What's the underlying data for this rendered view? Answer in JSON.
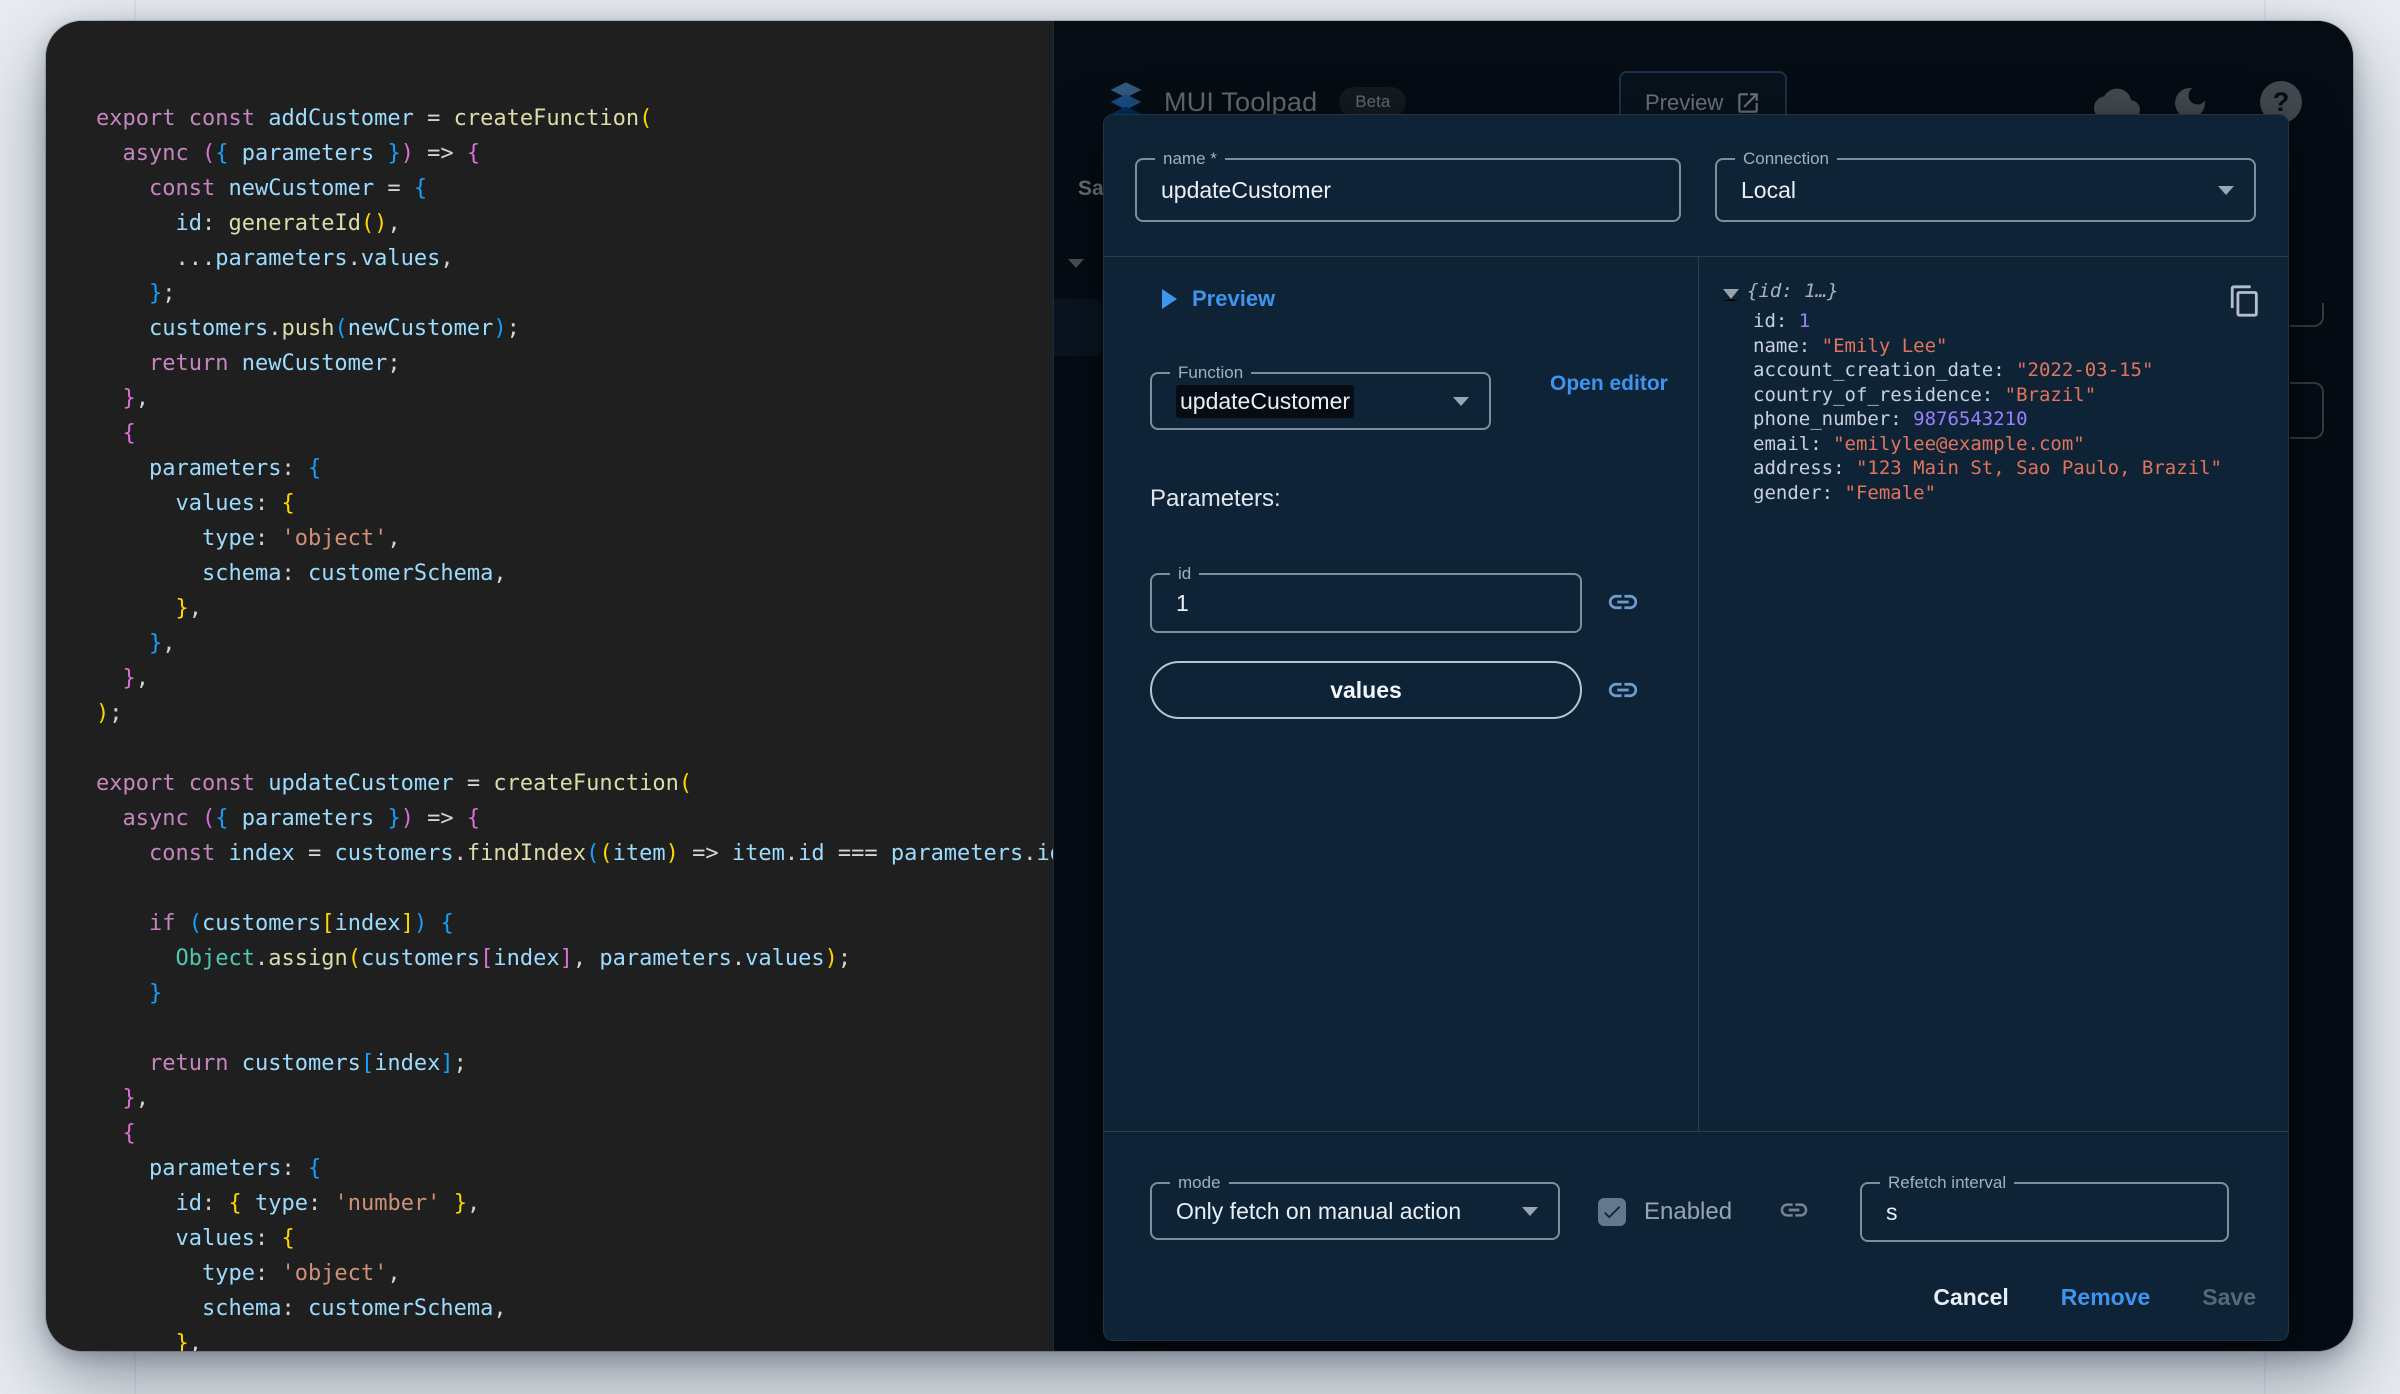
{
  "header": {
    "app_name": "MUI Toolpad",
    "beta_badge": "Beta",
    "preview_button": "Preview"
  },
  "background_ui": {
    "save_button_partial": "Sa"
  },
  "icons": {
    "help": "?"
  },
  "colors": {
    "accent_blue": "#3F94EE",
    "code_background": "#1f1f1f",
    "app_background": "#0A1929",
    "dialog_background": "#0f2337",
    "json_string": "#e0745c",
    "json_number": "#9980ff"
  },
  "code": {
    "lines": [
      [
        [
          "k",
          "export"
        ],
        [
          "p",
          " "
        ],
        [
          "k",
          "const"
        ],
        [
          "p",
          " "
        ],
        [
          "v",
          "addCustomer"
        ],
        [
          "p",
          " = "
        ],
        [
          "f",
          "createFunction"
        ],
        [
          "g",
          "("
        ]
      ],
      [
        [
          "p",
          "  "
        ],
        [
          "k",
          "async"
        ],
        [
          "p",
          " "
        ],
        [
          "m",
          "("
        ],
        [
          "b",
          "{"
        ],
        [
          "p",
          " "
        ],
        [
          "v",
          "parameters"
        ],
        [
          "p",
          " "
        ],
        [
          "b",
          "}"
        ],
        [
          "m",
          ")"
        ],
        [
          "p",
          " => "
        ],
        [
          "m",
          "{"
        ]
      ],
      [
        [
          "p",
          "    "
        ],
        [
          "k",
          "const"
        ],
        [
          "p",
          " "
        ],
        [
          "v",
          "newCustomer"
        ],
        [
          "p",
          " = "
        ],
        [
          "b",
          "{"
        ]
      ],
      [
        [
          "p",
          "      "
        ],
        [
          "v",
          "id"
        ],
        [
          "p",
          ": "
        ],
        [
          "f",
          "generateId"
        ],
        [
          "g",
          "()"
        ],
        [
          "p",
          ","
        ]
      ],
      [
        [
          "p",
          "      ..."
        ],
        [
          "v",
          "parameters"
        ],
        [
          "p",
          "."
        ],
        [
          "v",
          "values"
        ],
        [
          "p",
          ","
        ]
      ],
      [
        [
          "p",
          "    "
        ],
        [
          "b",
          "}"
        ],
        [
          "p",
          ";"
        ]
      ],
      [
        [
          "p",
          "    "
        ],
        [
          "v",
          "customers"
        ],
        [
          "p",
          "."
        ],
        [
          "f",
          "push"
        ],
        [
          "b",
          "("
        ],
        [
          "v",
          "newCustomer"
        ],
        [
          "b",
          ")"
        ],
        [
          "p",
          ";"
        ]
      ],
      [
        [
          "p",
          "    "
        ],
        [
          "k",
          "return"
        ],
        [
          "p",
          " "
        ],
        [
          "v",
          "newCustomer"
        ],
        [
          "p",
          ";"
        ]
      ],
      [
        [
          "p",
          "  "
        ],
        [
          "m",
          "}"
        ],
        [
          "p",
          ","
        ]
      ],
      [
        [
          "p",
          "  "
        ],
        [
          "m",
          "{"
        ]
      ],
      [
        [
          "p",
          "    "
        ],
        [
          "v",
          "parameters"
        ],
        [
          "p",
          ": "
        ],
        [
          "b",
          "{"
        ]
      ],
      [
        [
          "p",
          "      "
        ],
        [
          "v",
          "values"
        ],
        [
          "p",
          ": "
        ],
        [
          "g",
          "{"
        ]
      ],
      [
        [
          "p",
          "        "
        ],
        [
          "v",
          "type"
        ],
        [
          "p",
          ": "
        ],
        [
          "s",
          "'object'"
        ],
        [
          "p",
          ","
        ]
      ],
      [
        [
          "p",
          "        "
        ],
        [
          "v",
          "schema"
        ],
        [
          "p",
          ": "
        ],
        [
          "v",
          "customerSchema"
        ],
        [
          "p",
          ","
        ]
      ],
      [
        [
          "p",
          "      "
        ],
        [
          "g",
          "}"
        ],
        [
          "p",
          ","
        ]
      ],
      [
        [
          "p",
          "    "
        ],
        [
          "b",
          "}"
        ],
        [
          "p",
          ","
        ]
      ],
      [
        [
          "p",
          "  "
        ],
        [
          "m",
          "}"
        ],
        [
          "p",
          ","
        ]
      ],
      [
        [
          "g",
          ")"
        ],
        [
          "p",
          ";"
        ]
      ],
      [],
      [
        [
          "k",
          "export"
        ],
        [
          "p",
          " "
        ],
        [
          "k",
          "const"
        ],
        [
          "p",
          " "
        ],
        [
          "v",
          "updateCustomer"
        ],
        [
          "p",
          " = "
        ],
        [
          "f",
          "createFunction"
        ],
        [
          "g",
          "("
        ]
      ],
      [
        [
          "p",
          "  "
        ],
        [
          "k",
          "async"
        ],
        [
          "p",
          " "
        ],
        [
          "m",
          "("
        ],
        [
          "b",
          "{"
        ],
        [
          "p",
          " "
        ],
        [
          "v",
          "parameters"
        ],
        [
          "p",
          " "
        ],
        [
          "b",
          "}"
        ],
        [
          "m",
          ")"
        ],
        [
          "p",
          " => "
        ],
        [
          "m",
          "{"
        ]
      ],
      [
        [
          "p",
          "    "
        ],
        [
          "k",
          "const"
        ],
        [
          "p",
          " "
        ],
        [
          "v",
          "index"
        ],
        [
          "p",
          " = "
        ],
        [
          "v",
          "customers"
        ],
        [
          "p",
          "."
        ],
        [
          "f",
          "findIndex"
        ],
        [
          "b",
          "("
        ],
        [
          "g",
          "("
        ],
        [
          "v",
          "item"
        ],
        [
          "g",
          ")"
        ],
        [
          "p",
          " => "
        ],
        [
          "v",
          "item"
        ],
        [
          "p",
          "."
        ],
        [
          "v",
          "id"
        ],
        [
          "p",
          " === "
        ],
        [
          "v",
          "parameters"
        ],
        [
          "p",
          "."
        ],
        [
          "v",
          "id"
        ],
        [
          "b",
          ")"
        ],
        [
          "p",
          ";"
        ]
      ],
      [],
      [
        [
          "p",
          "    "
        ],
        [
          "k",
          "if"
        ],
        [
          "p",
          " "
        ],
        [
          "b",
          "("
        ],
        [
          "v",
          "customers"
        ],
        [
          "g",
          "["
        ],
        [
          "v",
          "index"
        ],
        [
          "g",
          "]"
        ],
        [
          "b",
          ")"
        ],
        [
          "p",
          " "
        ],
        [
          "b",
          "{"
        ]
      ],
      [
        [
          "p",
          "      "
        ],
        [
          "t",
          "Object"
        ],
        [
          "p",
          "."
        ],
        [
          "f",
          "assign"
        ],
        [
          "g",
          "("
        ],
        [
          "v",
          "customers"
        ],
        [
          "m",
          "["
        ],
        [
          "v",
          "index"
        ],
        [
          "m",
          "]"
        ],
        [
          "p",
          ", "
        ],
        [
          "v",
          "parameters"
        ],
        [
          "p",
          "."
        ],
        [
          "v",
          "values"
        ],
        [
          "g",
          ")"
        ],
        [
          "p",
          ";"
        ]
      ],
      [
        [
          "p",
          "    "
        ],
        [
          "b",
          "}"
        ]
      ],
      [],
      [
        [
          "p",
          "    "
        ],
        [
          "k",
          "return"
        ],
        [
          "p",
          " "
        ],
        [
          "v",
          "customers"
        ],
        [
          "b",
          "["
        ],
        [
          "v",
          "index"
        ],
        [
          "b",
          "]"
        ],
        [
          "p",
          ";"
        ]
      ],
      [
        [
          "p",
          "  "
        ],
        [
          "m",
          "}"
        ],
        [
          "p",
          ","
        ]
      ],
      [
        [
          "p",
          "  "
        ],
        [
          "m",
          "{"
        ]
      ],
      [
        [
          "p",
          "    "
        ],
        [
          "v",
          "parameters"
        ],
        [
          "p",
          ": "
        ],
        [
          "b",
          "{"
        ]
      ],
      [
        [
          "p",
          "      "
        ],
        [
          "v",
          "id"
        ],
        [
          "p",
          ": "
        ],
        [
          "g",
          "{"
        ],
        [
          "p",
          " "
        ],
        [
          "v",
          "type"
        ],
        [
          "p",
          ": "
        ],
        [
          "s",
          "'number'"
        ],
        [
          "p",
          " "
        ],
        [
          "g",
          "}"
        ],
        [
          "p",
          ","
        ]
      ],
      [
        [
          "p",
          "      "
        ],
        [
          "v",
          "values"
        ],
        [
          "p",
          ": "
        ],
        [
          "g",
          "{"
        ]
      ],
      [
        [
          "p",
          "        "
        ],
        [
          "v",
          "type"
        ],
        [
          "p",
          ": "
        ],
        [
          "s",
          "'object'"
        ],
        [
          "p",
          ","
        ]
      ],
      [
        [
          "p",
          "        "
        ],
        [
          "v",
          "schema"
        ],
        [
          "p",
          ": "
        ],
        [
          "v",
          "customerSchema"
        ],
        [
          "p",
          ","
        ]
      ],
      [
        [
          "p",
          "      "
        ],
        [
          "g",
          "}"
        ],
        [
          "p",
          ","
        ]
      ]
    ]
  },
  "dialog": {
    "name_field": {
      "label": "name *",
      "value": "updateCustomer"
    },
    "connection_field": {
      "label": "Connection",
      "value": "Local"
    },
    "preview_button_label": "Preview",
    "function_field": {
      "label": "Function",
      "value": "updateCustomer"
    },
    "open_editor_label": "Open editor",
    "parameters_heading": "Parameters:",
    "id_param_field": {
      "label": "id",
      "value": "1"
    },
    "values_param_button": "values",
    "result": {
      "summary": "{id: 1…}",
      "entries": [
        {
          "key": "id",
          "value": "1",
          "type": "number"
        },
        {
          "key": "name",
          "value": "\"Emily Lee\"",
          "type": "string"
        },
        {
          "key": "account_creation_date",
          "value": "\"2022-03-15\"",
          "type": "string"
        },
        {
          "key": "country_of_residence",
          "value": "\"Brazil\"",
          "type": "string"
        },
        {
          "key": "phone_number",
          "value": "9876543210",
          "type": "number"
        },
        {
          "key": "email",
          "value": "\"emilylee@example.com\"",
          "type": "string"
        },
        {
          "key": "address",
          "value": "\"123 Main St, Sao Paulo, Brazil\"",
          "type": "string"
        },
        {
          "key": "gender",
          "value": "\"Female\"",
          "type": "string"
        }
      ]
    },
    "footer": {
      "mode_field": {
        "label": "mode",
        "value": "Only fetch on manual action"
      },
      "enabled_label": "Enabled",
      "refetch_field": {
        "label": "Refetch interval",
        "value": "s"
      },
      "cancel_button": "Cancel",
      "remove_button": "Remove",
      "save_button": "Save"
    }
  }
}
